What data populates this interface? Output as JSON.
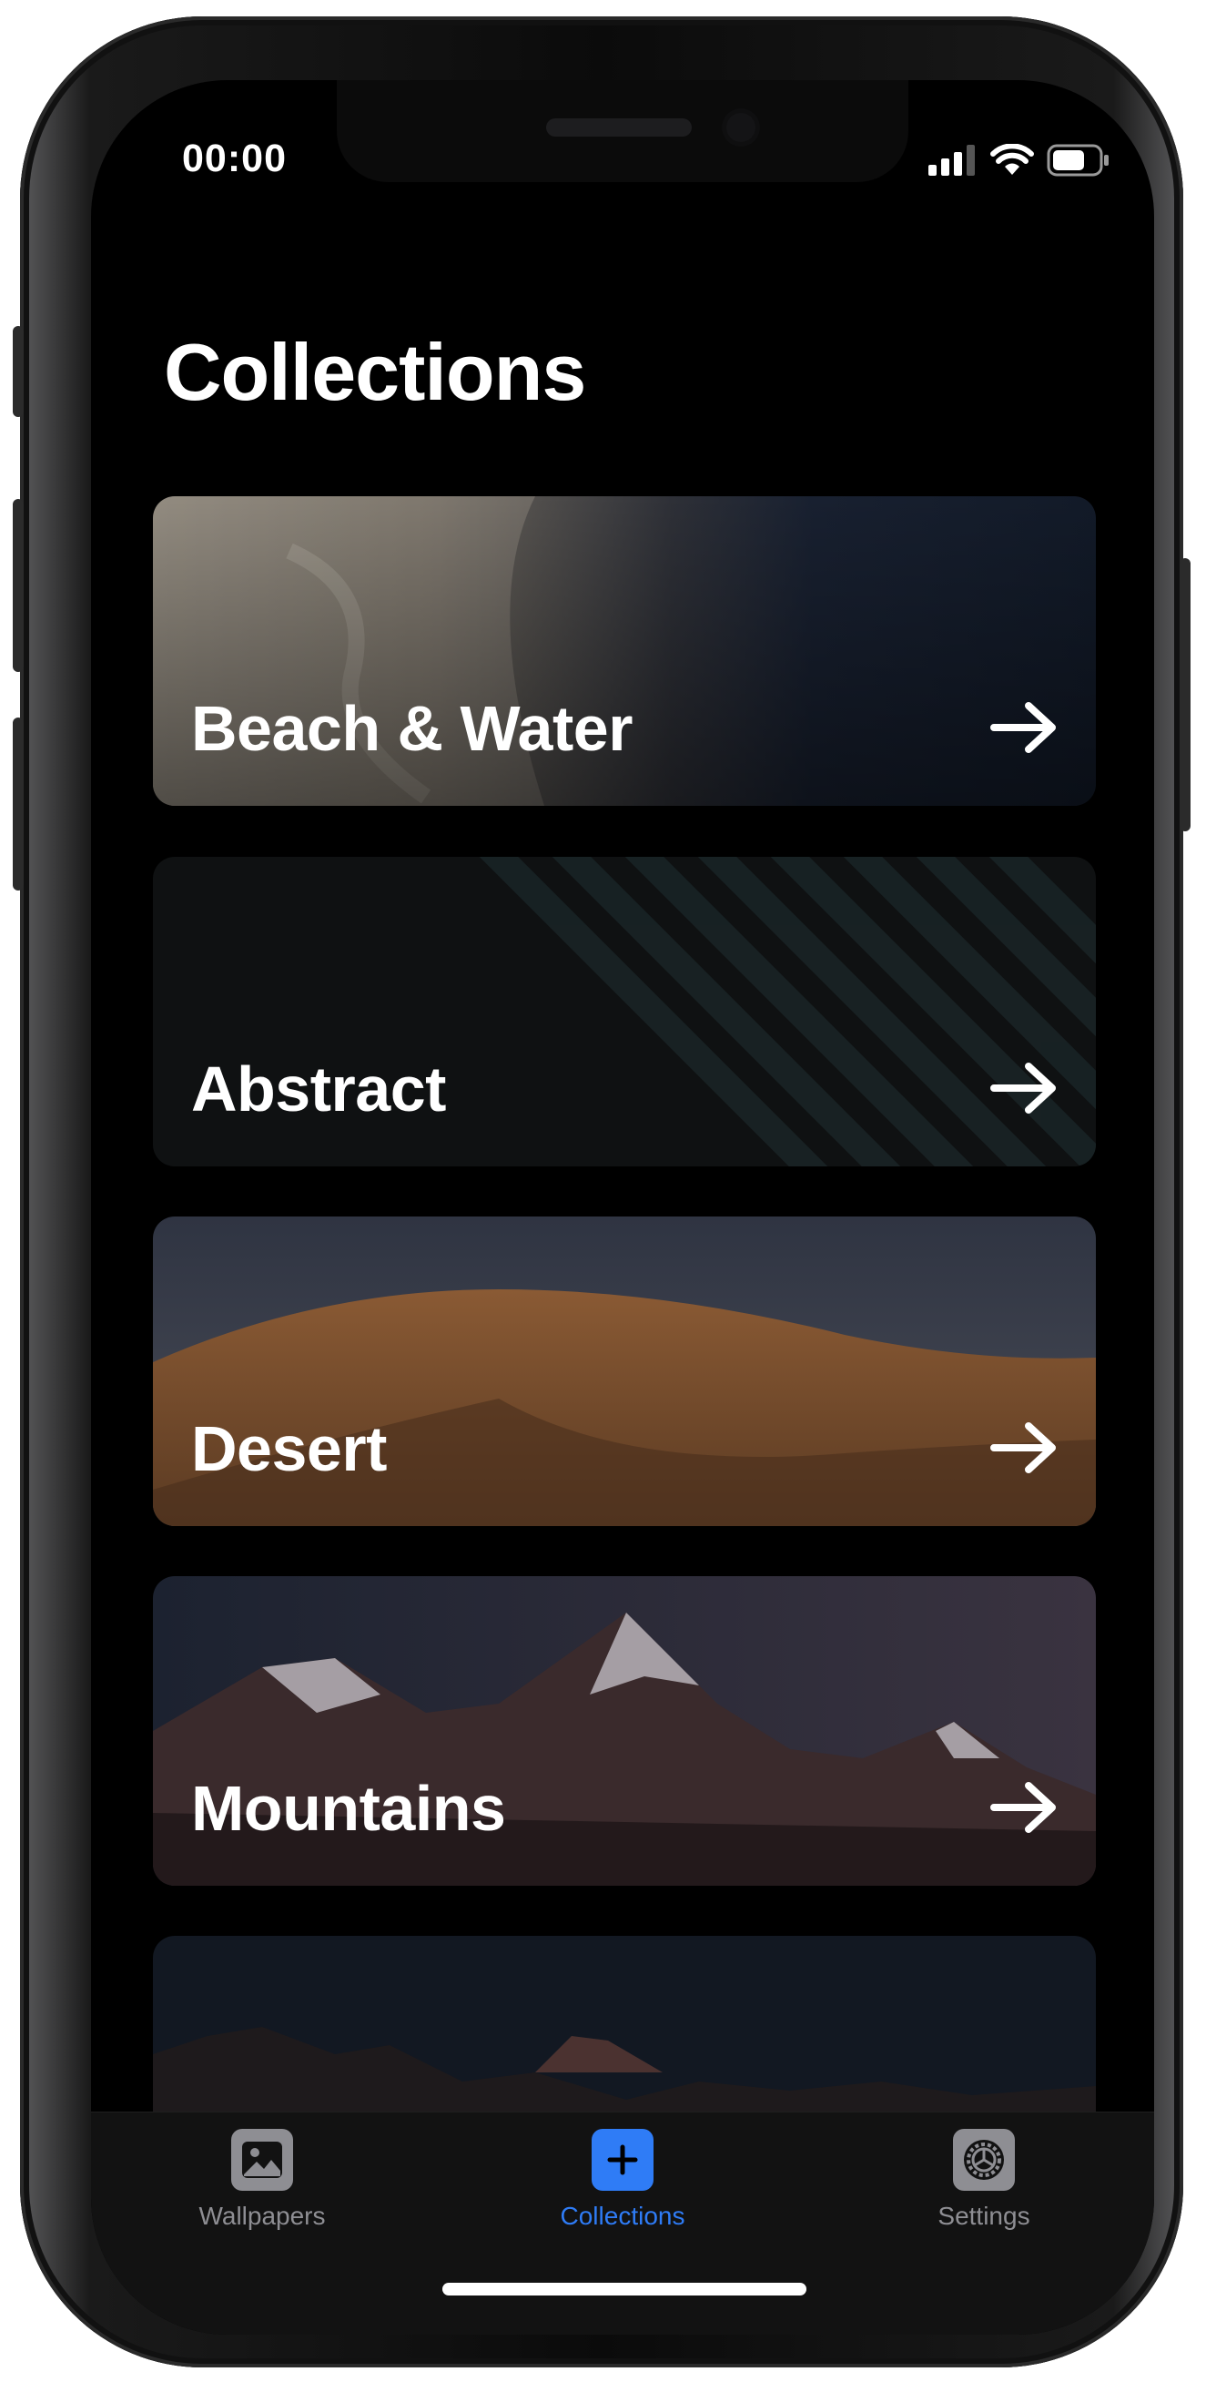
{
  "status_bar": {
    "time": "00:00"
  },
  "header": {
    "title": "Collections"
  },
  "collections": [
    {
      "label": "Beach & Water"
    },
    {
      "label": "Abstract"
    },
    {
      "label": "Desert"
    },
    {
      "label": "Mountains"
    },
    {
      "label": ""
    }
  ],
  "tab_bar": {
    "items": [
      {
        "label": "Wallpapers",
        "icon": "image-icon",
        "active": false
      },
      {
        "label": "Collections",
        "icon": "plus-icon",
        "active": true
      },
      {
        "label": "Settings",
        "icon": "gear-icon",
        "active": false
      }
    ]
  },
  "colors": {
    "accent": "#2f7cf6",
    "inactive": "#8e8e93",
    "background": "#000000"
  }
}
